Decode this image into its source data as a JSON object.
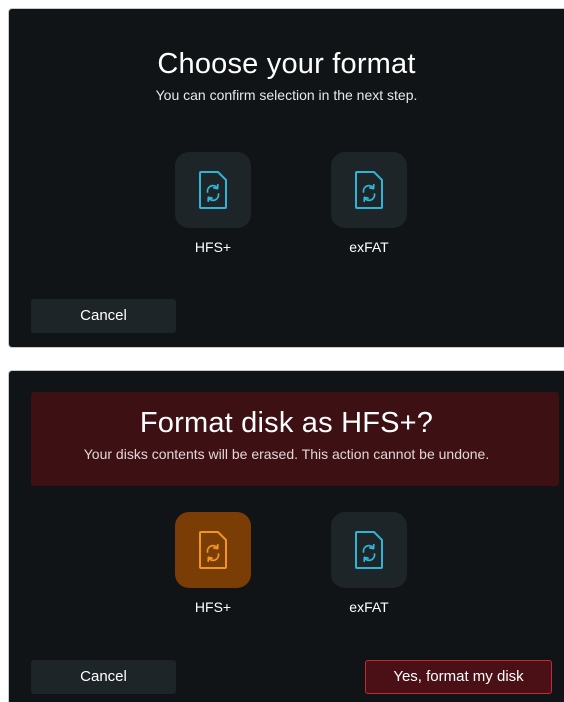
{
  "choose_screen": {
    "title": "Choose your format",
    "subtitle": "You can confirm selection in the next step.",
    "formats": [
      {
        "label": "HFS+",
        "icon": "disk-format-icon",
        "selected": false
      },
      {
        "label": "exFAT",
        "icon": "disk-format-icon",
        "selected": false
      }
    ],
    "cancel_label": "Cancel"
  },
  "confirm_screen": {
    "title": "Format disk as HFS+?",
    "subtitle": "Your disks contents will be erased. This action cannot be undone.",
    "formats": [
      {
        "label": "HFS+",
        "icon": "disk-format-icon",
        "selected": true
      },
      {
        "label": "exFAT",
        "icon": "disk-format-icon",
        "selected": false
      }
    ],
    "cancel_label": "Cancel",
    "confirm_label": "Yes, format my disk"
  },
  "colors": {
    "background": "#111416",
    "tile": "#1e2529",
    "tile_selected": "#7a3d05",
    "icon_default": "#2fb4d6",
    "icon_selected": "#f0951e",
    "warning_banner": "#3d1014",
    "confirm_border": "#c02b36"
  }
}
